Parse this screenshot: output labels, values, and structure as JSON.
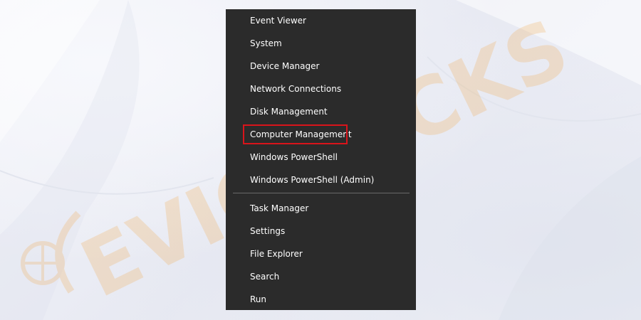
{
  "menu": {
    "group1": [
      {
        "id": "event-viewer",
        "label": "Event Viewer"
      },
      {
        "id": "system",
        "label": "System"
      },
      {
        "id": "device-manager",
        "label": "Device Manager"
      },
      {
        "id": "network-connections",
        "label": "Network Connections"
      },
      {
        "id": "disk-management",
        "label": "Disk Management"
      },
      {
        "id": "computer-management",
        "label": "Computer Management"
      },
      {
        "id": "windows-powershell",
        "label": "Windows PowerShell"
      },
      {
        "id": "windows-powershell-admin",
        "label": "Windows PowerShell (Admin)"
      }
    ],
    "group2": [
      {
        "id": "task-manager",
        "label": "Task Manager"
      },
      {
        "id": "settings",
        "label": "Settings"
      },
      {
        "id": "file-explorer",
        "label": "File Explorer"
      },
      {
        "id": "search",
        "label": "Search"
      },
      {
        "id": "run",
        "label": "Run"
      }
    ],
    "highlighted": "computer-management"
  },
  "watermark": {
    "text": "EVICTRICKS"
  },
  "colors": {
    "menu_bg": "#2b2b2b",
    "menu_text": "#ffffff",
    "separator": "#6a6a6a",
    "highlight": "#d9141b",
    "watermark": "#f2a23a"
  }
}
